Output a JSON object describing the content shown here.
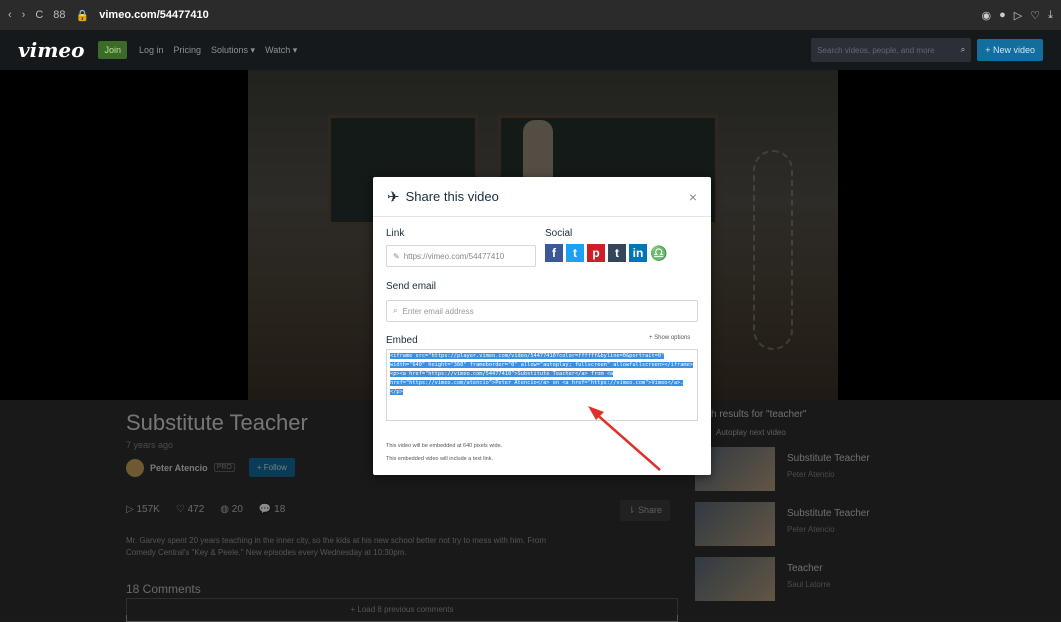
{
  "browser": {
    "url": "vimeo.com/54477410",
    "nav": "C",
    "grid": "88"
  },
  "header": {
    "logo": "vimeo",
    "join": "Join",
    "links": [
      "Log in",
      "Pricing",
      "Solutions ▾",
      "Watch ▾"
    ],
    "search_placeholder": "Search videos, people, and more",
    "new_video": "+ New video"
  },
  "video": {
    "title": "Substitute Teacher",
    "ago": "7 years ago",
    "author": "Peter Atencio",
    "badge": "PRO",
    "follow": "+ Follow",
    "plays": "157K",
    "likes": "472",
    "collections": "20",
    "comments_count": "18",
    "share": "Share",
    "description": "Mr. Garvey spent 20 years teaching in the inner city, so the kids at his new school better not try to mess with him. From Comedy Central's \"Key & Peele.\" New episodes every Wednesday at 10:30pm.",
    "comments_heading": "18 Comments",
    "load_more": "+ Load 8 previous comments"
  },
  "sidebar": {
    "title": "ch results for \"teacher\"",
    "autoplay": "Autoplay next video",
    "items": [
      {
        "title": "Substitute Teacher",
        "author": "Peter Atencio"
      },
      {
        "title": "Substitute Teacher",
        "author": "Peter Atencio"
      },
      {
        "title": "Teacher",
        "author": "Saul Latorre"
      }
    ]
  },
  "modal": {
    "title": "Share this video",
    "close": "×",
    "link_label": "Link",
    "link_value": "https://vimeo.com/54477410",
    "social_label": "Social",
    "social": [
      "f",
      "t",
      "p",
      "t",
      "in"
    ],
    "email_label": "Send email",
    "email_placeholder": "Enter email address",
    "embed_label": "Embed",
    "show_options": "+ Show options",
    "embed_code": "<iframe src=\"https://player.vimeo.com/video/54477410?color=ffffff&byline=0&portrait=0\" width=\"640\" height=\"360\" frameborder=\"0\" allow=\"autoplay; fullscreen\" allowfullscreen></iframe><p><a href=\"https://vimeo.com/54477410\">Substitute Teacher</a> from <a href=\"https://vimeo.com/atencio\">Peter Atencio</a> on <a href=\"https://vimeo.com\">Vimeo</a>.</p>",
    "note1": "This video will be embedded at 640 pixels wide.",
    "note2": "This embedded video will include a text link."
  },
  "colors": {
    "accent": "#136ea0",
    "highlight": "#3f8fe0",
    "annotation": "#e0302c"
  }
}
